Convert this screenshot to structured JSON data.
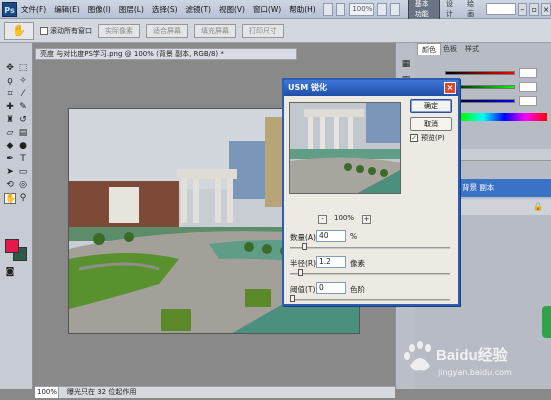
{
  "menubar": {
    "logo": "Ps",
    "items": [
      "文件(F)",
      "编辑(E)",
      "图像(I)",
      "图层(L)",
      "选择(S)",
      "滤镜(T)",
      "视图(V)",
      "窗口(W)",
      "帮助(H)"
    ],
    "zoom": "100%",
    "workspace_active": "基本功能",
    "workspace_links": [
      "设计",
      "绘画"
    ]
  },
  "optionsbar": {
    "scroll_all_label": "滚动所有窗口",
    "buttons": [
      "实际像素",
      "适合屏幕",
      "填充屏幕",
      "打印尺寸"
    ]
  },
  "document": {
    "tab_title": "亮度 与对比度PS学习.png @ 100% (背景 副本, RGB/8) *",
    "status_zoom": "100%",
    "status_text": "曝光只在 32 位起作用"
  },
  "right_panel": {
    "tabs": [
      "颜色",
      "色板",
      "样式"
    ],
    "layer_name": "背景 副本"
  },
  "dialog": {
    "title": "USM 锐化",
    "ok_label": "确定",
    "cancel_label": "取消",
    "preview_label": "预览(P)",
    "preview_checked": true,
    "zoom_minus": "-",
    "zoom_plus": "+",
    "zoom_level": "100%",
    "fields": [
      {
        "label": "数量(A):",
        "value": "40",
        "unit": "%",
        "slider_fraction": 0.08
      },
      {
        "label": "半径(R):",
        "value": "1.2",
        "unit": "像素",
        "slider_fraction": 0.05
      },
      {
        "label": "阈值(T):",
        "value": "0",
        "unit": "色阶",
        "slider_fraction": 0.0
      }
    ]
  },
  "watermark": {
    "text": "Baidu经验",
    "url": "jingyan.baidu.com"
  },
  "colors": {
    "foreground": "#e6174a",
    "background": "#2d5a4a",
    "selection_blue": "#3a72c8",
    "dialog_title": "#1f4fa9"
  }
}
